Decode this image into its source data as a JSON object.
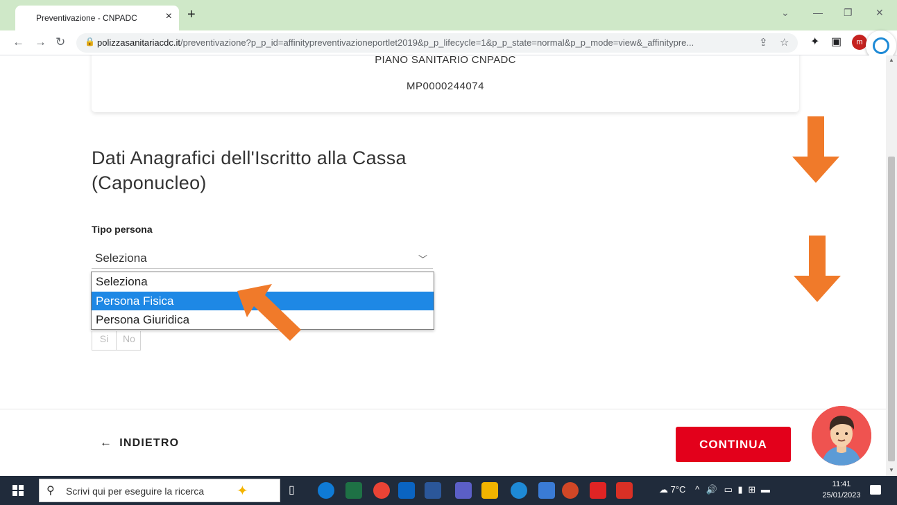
{
  "browser": {
    "tab_title": "Preventivazione - CNPADC",
    "close_glyph": "×",
    "new_tab_glyph": "+",
    "url_host": "polizzasanitariacdc.it",
    "url_rest": "/preventivazione?p_p_id=affinitypreventivazioneportlet2019&p_p_lifecycle=1&p_p_state=normal&p_p_mode=view&_affinitypre...",
    "profile_initial": "m"
  },
  "card": {
    "plan_name": "PIANO SANITARIO CNPADC",
    "code": "MP0000244074"
  },
  "form": {
    "section_title": "Dati Anagrafici dell'Iscritto alla Cassa (Caponucleo)",
    "tipo_label": "Tipo persona",
    "select_value": "Seleziona",
    "options": [
      "Seleziona",
      "Persona Fisica",
      "Persona Giuridica"
    ],
    "highlighted_option": "Persona Fisica",
    "toggle_si": "Si",
    "toggle_no": "No"
  },
  "footer": {
    "back_label": "INDIETRO",
    "back_arrow": "←",
    "continue_label": "CONTINUA"
  },
  "annotations": {
    "arrow_color": "#f07a2a"
  },
  "taskbar": {
    "search_placeholder": "Scrivi qui per eseguire la ricerca",
    "weather": "7°C",
    "time": "11:41",
    "date": "25/01/2023"
  }
}
